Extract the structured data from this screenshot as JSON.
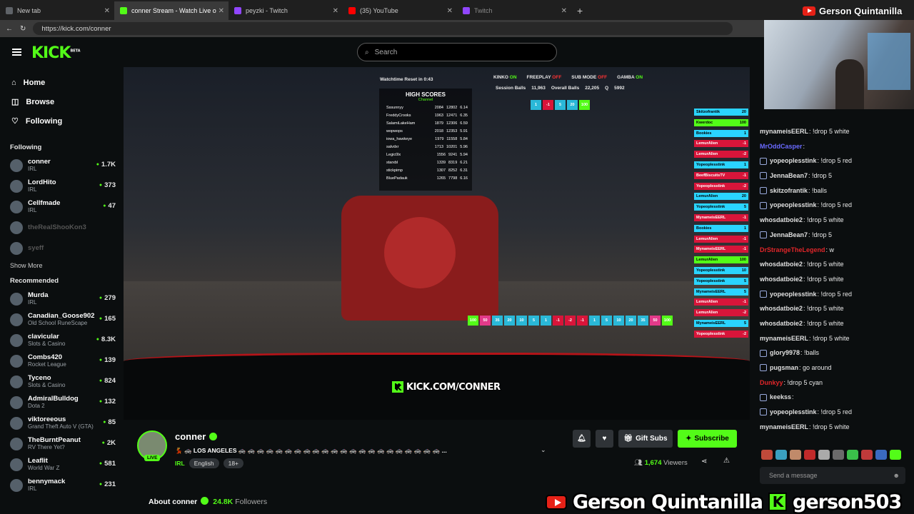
{
  "browser": {
    "tabs": [
      {
        "title": "New tab",
        "color": "#5f6368"
      },
      {
        "title": "conner Stream - Watch Live o",
        "color": "#53fc18"
      },
      {
        "title": "peyzki - Twitch",
        "color": "#9146ff"
      },
      {
        "title": "(35) YouTube",
        "color": "#ff0000"
      },
      {
        "title": "Twitch",
        "color": "#9146ff"
      }
    ],
    "new_tab": "+",
    "url": "https://kick.com/conner"
  },
  "header": {
    "logo": "KICK",
    "logo_sup": "BETA",
    "search_placeholder": "Search"
  },
  "sidebar": {
    "nav": [
      {
        "label": "Home",
        "icon": "home-icon"
      },
      {
        "label": "Browse",
        "icon": "browse-icon"
      },
      {
        "label": "Following",
        "icon": "heart-icon"
      }
    ],
    "following_title": "Following",
    "following": [
      {
        "name": "conner",
        "category": "IRL",
        "viewers": "1.7K"
      },
      {
        "name": "LordHito",
        "category": "IRL",
        "viewers": "373"
      },
      {
        "name": "Cellfmade",
        "category": "IRL",
        "viewers": "47"
      },
      {
        "name": "theRealShooKon3",
        "category": "",
        "viewers": ""
      },
      {
        "name": "syeff",
        "category": "",
        "viewers": ""
      }
    ],
    "show_more": "Show More",
    "recommended_title": "Recommended",
    "recommended": [
      {
        "name": "Murda",
        "category": "IRL",
        "viewers": "279"
      },
      {
        "name": "Canadian_Goose902",
        "category": "Old School RuneScape",
        "viewers": "165"
      },
      {
        "name": "clavicular",
        "category": "Slots & Casino",
        "viewers": "8.3K"
      },
      {
        "name": "Combs420",
        "category": "Rocket League",
        "viewers": "139"
      },
      {
        "name": "Tyceno",
        "category": "Slots & Casino",
        "viewers": "824"
      },
      {
        "name": "AdmiralBulldog",
        "category": "Dota 2",
        "viewers": "132"
      },
      {
        "name": "viktoreeous",
        "category": "Grand Theft Auto V (GTA)",
        "viewers": "85"
      },
      {
        "name": "TheBurntPeanut",
        "category": "RV There Yet?",
        "viewers": "2K"
      },
      {
        "name": "Leaflit",
        "category": "World War Z",
        "viewers": "581"
      },
      {
        "name": "bennymack",
        "category": "IRL",
        "viewers": "231"
      }
    ]
  },
  "video": {
    "watchtime": "Watchtime Reset in 0:43",
    "flags": [
      {
        "label": "KINKO",
        "state": "ON"
      },
      {
        "label": "FREEPLAY",
        "state": "OFF"
      },
      {
        "label": "SUB MODE",
        "state": "OFF"
      },
      {
        "label": "GAMBA",
        "state": "ON"
      }
    ],
    "session_balls_label": "Session Balls",
    "session_balls": "11,963",
    "overall_balls_label": "Overall Balls",
    "overall_balls": "22,205",
    "q_label": "Q",
    "q_value": "5992",
    "highscores_title": "HIGH SCORES",
    "highscores_sub": "Channel",
    "highscores": [
      [
        "Sssunnyy",
        "2084",
        "12802",
        "6.14"
      ],
      [
        "FreddyCrooks",
        "1963",
        "12471",
        "6.35"
      ],
      [
        "SalamiLakeHam",
        "1879",
        "12306",
        "6.59"
      ],
      [
        "wopwops",
        "2018",
        "12353",
        "5.91"
      ],
      [
        "iowa_hawkeye",
        "1979",
        "11558",
        "5.84"
      ],
      [
        "salvdxr",
        "1713",
        "10201",
        "5.96"
      ],
      [
        "Legic0lx",
        "1556",
        "9241",
        "5.94"
      ],
      [
        "starxbl",
        "1339",
        "8319",
        "6.21"
      ],
      [
        "stickpimp",
        "1307",
        "8252",
        "6.31"
      ],
      [
        "BluePadauk",
        "1265",
        "7798",
        "6.16"
      ]
    ],
    "top_buttons": [
      "1",
      "-1",
      "5",
      "20",
      "100"
    ],
    "bottom_buttons": [
      "100",
      "50",
      "35",
      "20",
      "10",
      "5",
      "1",
      "-1",
      "-2",
      "-1",
      "1",
      "5",
      "10",
      "20",
      "35",
      "50",
      "100"
    ],
    "side_tags": [
      [
        "Skitzofrantik",
        "20"
      ],
      [
        "Kwerdoc",
        "100"
      ],
      [
        "Bookies",
        "1"
      ],
      [
        "LemurAlien",
        "-1"
      ],
      [
        "LemurAlien",
        "-2"
      ],
      [
        "Yopeoplesstink",
        "1"
      ],
      [
        "BeefBiscuitsTV",
        "-1"
      ],
      [
        "Yopeoplesstink",
        "-2"
      ],
      [
        "LemurAlien",
        "20"
      ],
      [
        "Yopeoplesstink",
        "5"
      ],
      [
        "MynameisEERL",
        "-1"
      ],
      [
        "Bookies",
        "1"
      ],
      [
        "LemurAlien",
        "-1"
      ],
      [
        "MynameisEERL",
        "-1"
      ],
      [
        "LemurAlien",
        "100"
      ],
      [
        "Yopeoplesstink",
        "10"
      ],
      [
        "Yopeoplesstink",
        "5"
      ],
      [
        "MynameisEERL",
        "5"
      ],
      [
        "LemurAlien",
        "-1"
      ],
      [
        "LemurAlien",
        "-2"
      ],
      [
        "MynameisEERL",
        "5"
      ],
      [
        "Yopeoplesstink",
        "-2"
      ]
    ],
    "watermark": "KICK.COM/CONNER"
  },
  "stream": {
    "name": "conner",
    "live": "LIVE",
    "title": "💃 🚓 LOS ANGELES 🚓 🚓 🚓 🚓 🚓 🚓 🚓 🚓 🚓 🚓 🚓 🚓 🚓 🚓 🚓 🚓 🚓 🚓 🚓 🚓 🚓 🚓 ...",
    "category": "IRL",
    "language": "English",
    "age": "18+",
    "gift_subs": "Gift Subs",
    "subscribe": "Subscribe",
    "viewers": "1,674",
    "viewers_label": "Viewers",
    "about": "About conner",
    "followers": "24.8K",
    "followers_label": "Followers"
  },
  "chat": {
    "messages": [
      {
        "user": "mynameisEERL",
        "text": ": !drop 5 white",
        "color": "#e0e0e0"
      },
      {
        "user": "MrOddCasper",
        "text": ":",
        "color": "#6a6aff"
      },
      {
        "user": "yopeoplesstink",
        "text": ": !drop 5 red",
        "color": "#e0e0e0",
        "badge": true
      },
      {
        "user": "JennaBean7",
        "text": ": !drop 5",
        "color": "#e0e0e0",
        "badge": true
      },
      {
        "user": "skitzofrantik",
        "text": ": !balls",
        "color": "#e0e0e0",
        "badge": true
      },
      {
        "user": "yopeoplesstink",
        "text": ": !drop 5 red",
        "color": "#e0e0e0",
        "badge": true
      },
      {
        "user": "whosdatboie2",
        "text": ": !drop 5 white",
        "color": "#e0e0e0"
      },
      {
        "user": "JennaBean7",
        "text": ": !drop 5",
        "color": "#e0e0e0",
        "badge": true
      },
      {
        "user": "DrStrangeTheLegend",
        "text": ": w",
        "color": "#e0262a"
      },
      {
        "user": "whosdatboie2",
        "text": ": !drop 5 white",
        "color": "#e0e0e0"
      },
      {
        "user": "whosdatboie2",
        "text": ": !drop 5 white",
        "color": "#e0e0e0"
      },
      {
        "user": "yopeoplesstink",
        "text": ": !drop 5 red",
        "color": "#e0e0e0",
        "badge": true
      },
      {
        "user": "whosdatboie2",
        "text": ": !drop 5 white",
        "color": "#e0e0e0"
      },
      {
        "user": "whosdatboie2",
        "text": ": !drop 5 white",
        "color": "#e0e0e0"
      },
      {
        "user": "mynameisEERL",
        "text": ": !drop 5 white",
        "color": "#e0e0e0"
      },
      {
        "user": "glory9978",
        "text": ": !balls",
        "color": "#e0e0e0",
        "badge": true
      },
      {
        "user": "pugsman",
        "text": ": go around",
        "color": "#e0e0e0",
        "badge": true
      },
      {
        "user": "Dunkyy",
        "text": ": !drop 5 cyan",
        "color": "#e0262a"
      },
      {
        "user": "keekss",
        "text": ":",
        "color": "#e0e0e0",
        "badge": true
      },
      {
        "user": "yopeoplesstink",
        "text": ": !drop 5 red",
        "color": "#e0e0e0",
        "badge": true
      },
      {
        "user": "mynameisEERL",
        "text": ": !drop 5 white",
        "color": "#e0e0e0"
      }
    ],
    "placeholder": "Send a message"
  },
  "overlay": {
    "cam_name": "Gerson Quintanilla",
    "bottom_youtube": "Gerson Quintanilla",
    "bottom_kick": "gerson503"
  },
  "colors": {
    "accent": "#53fc18",
    "brand_bg": "#0b0e0f"
  }
}
